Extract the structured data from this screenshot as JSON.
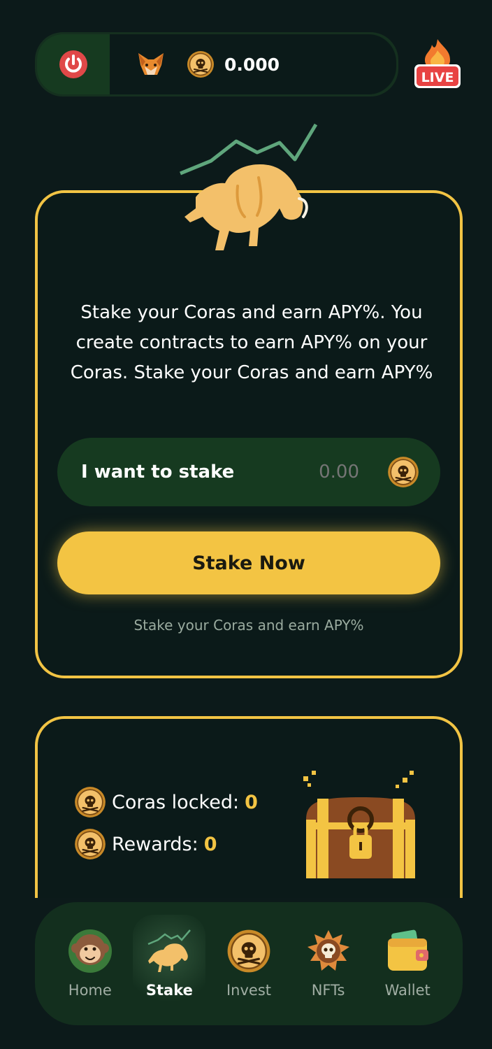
{
  "header": {
    "balance": "0.000",
    "live_badge": "LIVE"
  },
  "stake_card": {
    "description": "Stake your Coras and earn APY%. You create contracts to earn APY% on your Coras. Stake your Coras and earn APY%",
    "input_label": "I want to stake",
    "input_placeholder": "0.00",
    "button_label": "Stake Now",
    "note": "Stake your Coras and earn APY%"
  },
  "locked_card": {
    "locked_label": "Coras locked:",
    "locked_value": "0",
    "rewards_label": "Rewards:",
    "rewards_value": "0"
  },
  "nav": {
    "items": [
      {
        "label": "Home",
        "icon": "monkey-icon"
      },
      {
        "label": "Stake",
        "icon": "bull-icon",
        "active": true
      },
      {
        "label": "Invest",
        "icon": "skull-coin-icon"
      },
      {
        "label": "NFTs",
        "icon": "skull-badge-icon"
      },
      {
        "label": "Wallet",
        "icon": "wallet-icon"
      }
    ]
  },
  "colors": {
    "background": "#0c1a1a",
    "accent": "#f3c443",
    "panel": "#132f1e",
    "input_bg": "#163a20"
  }
}
